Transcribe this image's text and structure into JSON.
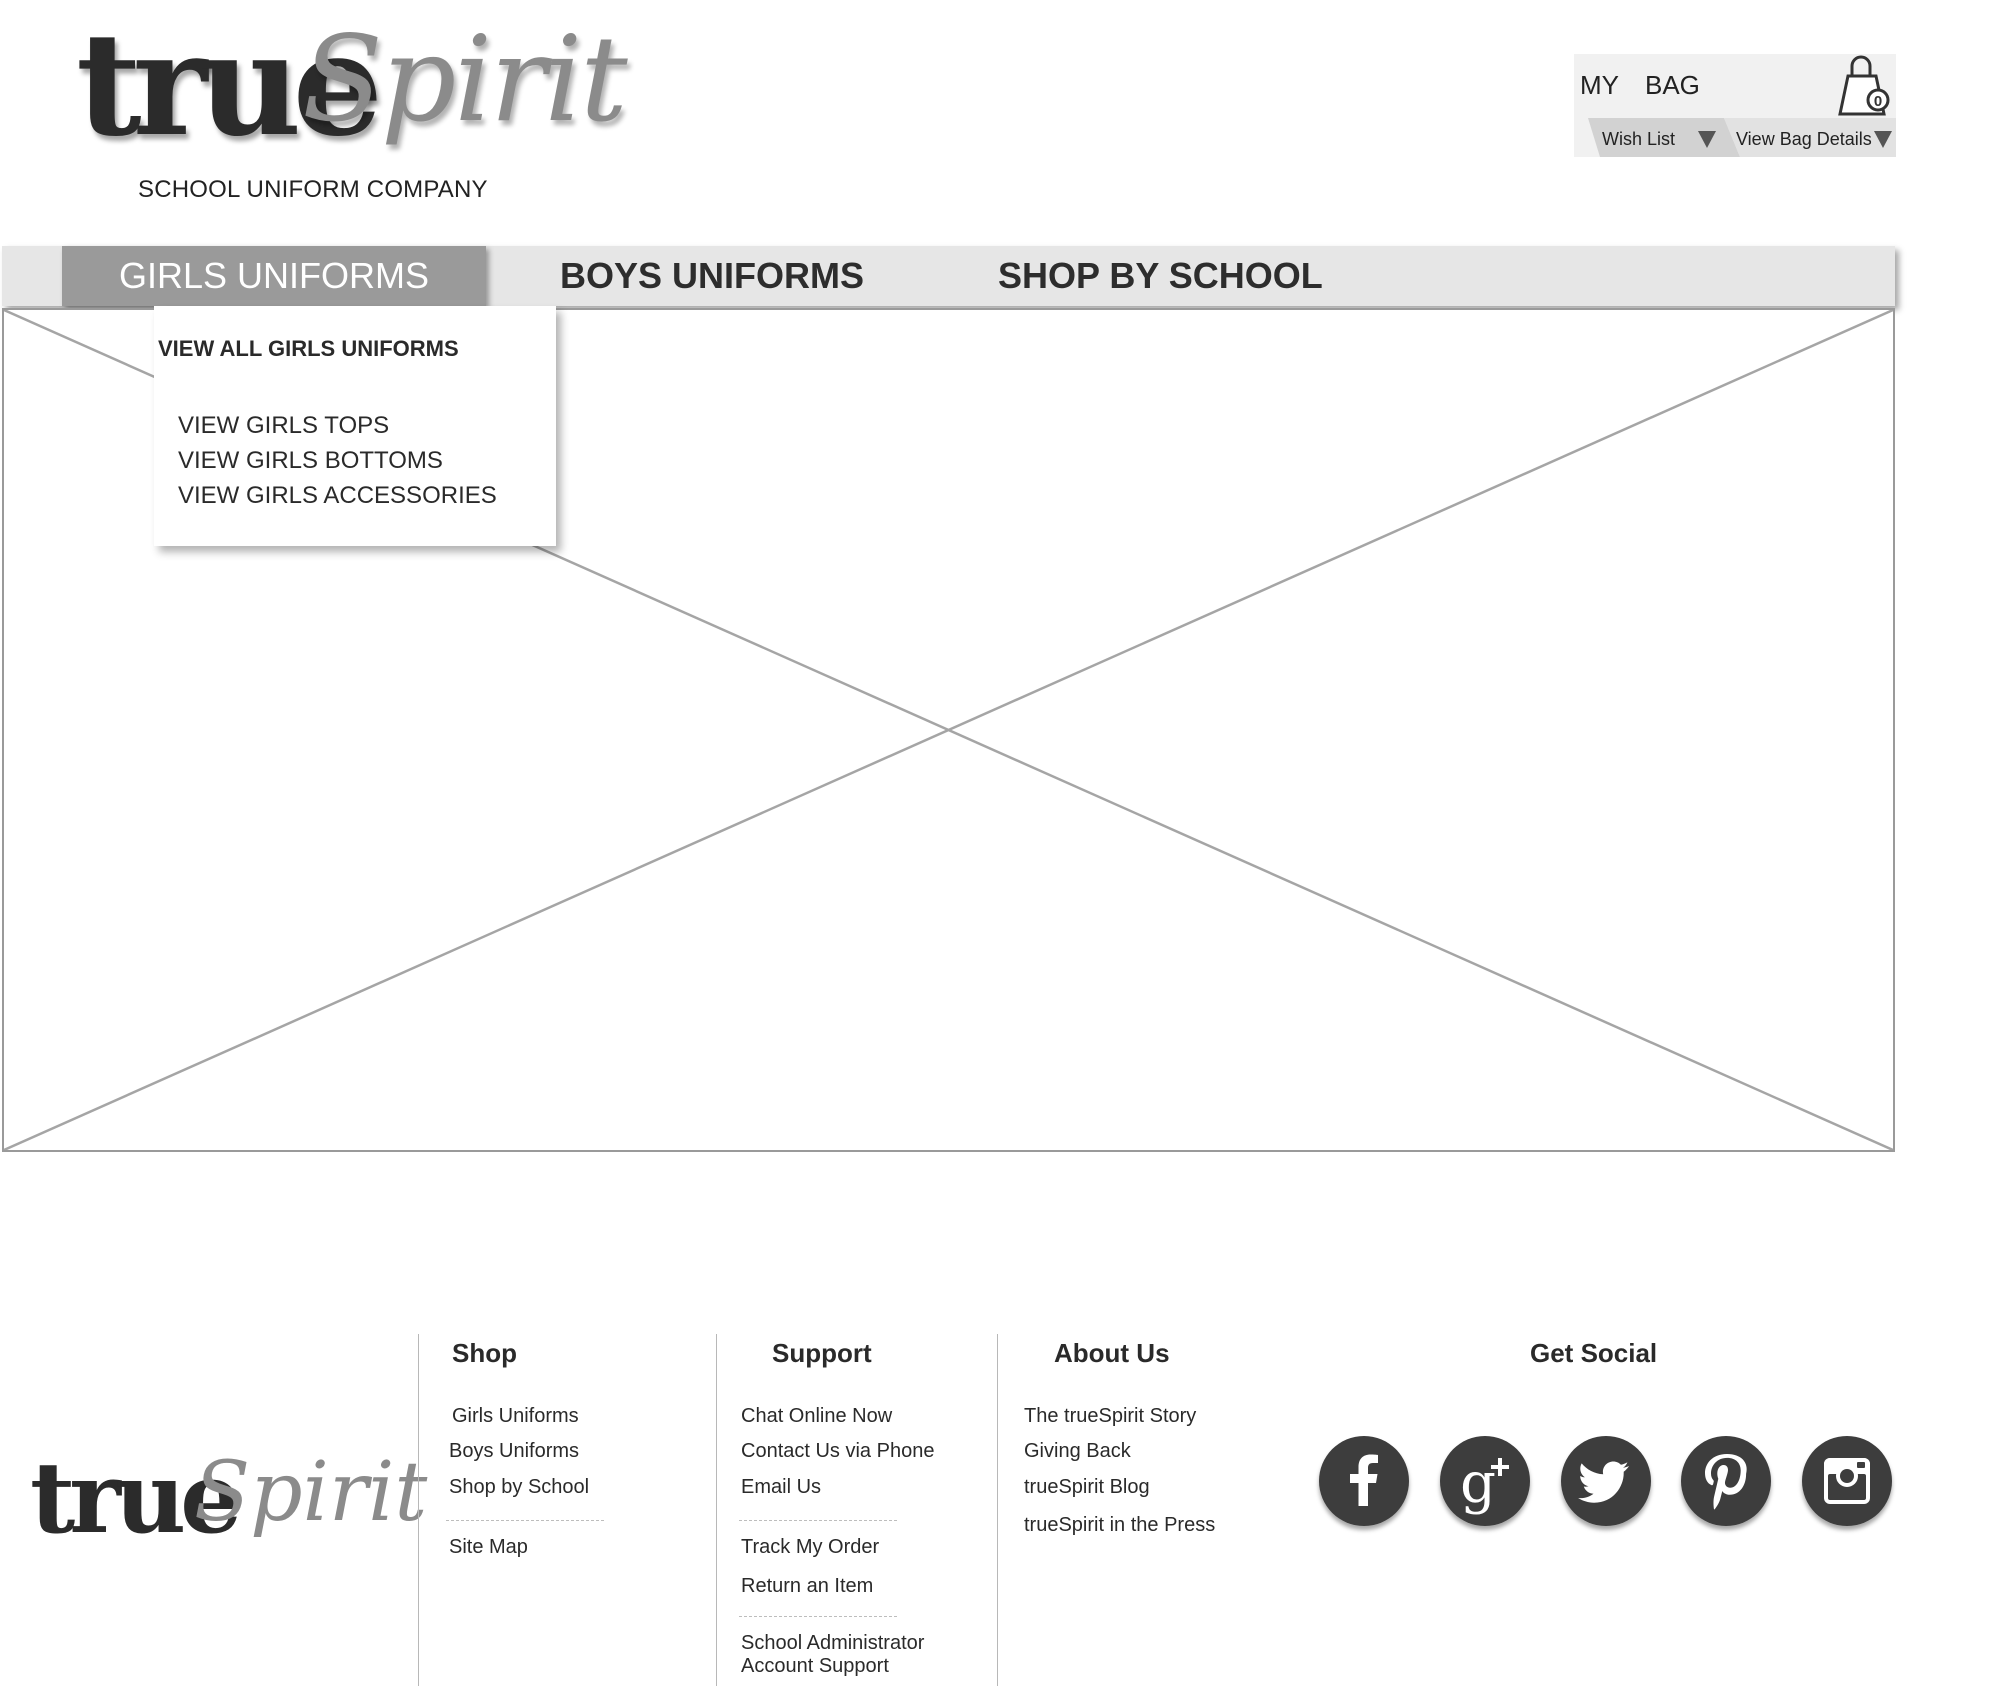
{
  "header": {
    "logo_part1": "true",
    "logo_part2": "Spirit",
    "tagline": "SCHOOL UNIFORM COMPANY"
  },
  "bag": {
    "title": "MY  BAG",
    "count": "0",
    "wish_list": "Wish List",
    "view_details": "View Bag Details"
  },
  "nav": {
    "girls": "GIRLS UNIFORMS",
    "boys": "BOYS UNIFORMS",
    "school": "SHOP BY SCHOOL"
  },
  "dropdown": {
    "view_all": "VIEW ALL GIRLS UNIFORMS",
    "items": [
      "VIEW GIRLS TOPS",
      "VIEW GIRLS BOTTOMS",
      "VIEW GIRLS ACCESSORIES"
    ]
  },
  "footer": {
    "logo_part1": "true",
    "logo_part2": "Spirit",
    "shop": {
      "heading": "Shop",
      "links": [
        "Girls Uniforms",
        "Boys Uniforms",
        "Shop by School"
      ],
      "site_map": "Site Map"
    },
    "support": {
      "heading": "Support",
      "links": [
        "Chat Online Now",
        "Contact Us via Phone",
        "Email Us"
      ],
      "links2": [
        "Track My Order",
        "Return an Item"
      ],
      "admin_line1": "School Administrator",
      "admin_line2": "Account Support"
    },
    "about": {
      "heading": "About Us",
      "links": [
        "The trueSpirit Story",
        "Giving Back",
        "trueSpirit Blog",
        "trueSpirit in the Press"
      ]
    },
    "social": {
      "heading": "Get Social",
      "icons": [
        "facebook-icon",
        "google-plus-icon",
        "twitter-icon",
        "pinterest-icon",
        "instagram-icon"
      ]
    }
  },
  "colors": {
    "nav_bg": "#e6e6e6",
    "nav_active": "#9a9a9a",
    "text": "#2a2a2a",
    "social_bg": "#3d3d3d"
  }
}
